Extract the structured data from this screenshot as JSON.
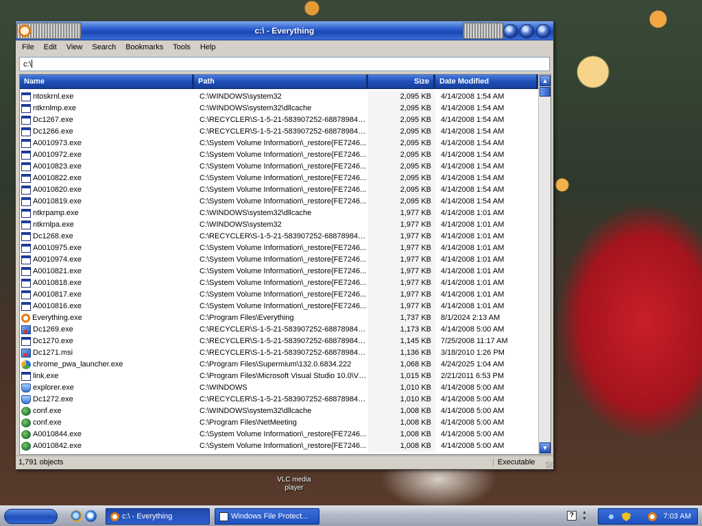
{
  "window": {
    "title": "c:\\ - Everything"
  },
  "menu": [
    "File",
    "Edit",
    "View",
    "Search",
    "Bookmarks",
    "Tools",
    "Help"
  ],
  "search": {
    "value": "c:\\"
  },
  "columns": {
    "name": "Name",
    "path": "Path",
    "size": "Size",
    "date": "Date Modified"
  },
  "rows": [
    {
      "name": "ntoskrnl.exe",
      "path": "C:\\WINDOWS\\system32",
      "size": "2,095 KB",
      "date": "4/14/2008 1:54 AM",
      "icon": "exe"
    },
    {
      "name": "ntkrnlmp.exe",
      "path": "C:\\WINDOWS\\system32\\dllcache",
      "size": "2,095 KB",
      "date": "4/14/2008 1:54 AM",
      "icon": "exe"
    },
    {
      "name": "Dc1267.exe",
      "path": "C:\\RECYCLER\\S-1-5-21-583907252-688789844-...",
      "size": "2,095 KB",
      "date": "4/14/2008 1:54 AM",
      "icon": "exe"
    },
    {
      "name": "Dc1266.exe",
      "path": "C:\\RECYCLER\\S-1-5-21-583907252-688789844-...",
      "size": "2,095 KB",
      "date": "4/14/2008 1:54 AM",
      "icon": "exe"
    },
    {
      "name": "A0010973.exe",
      "path": "C:\\System Volume Information\\_restore{FE7246...",
      "size": "2,095 KB",
      "date": "4/14/2008 1:54 AM",
      "icon": "exe"
    },
    {
      "name": "A0010972.exe",
      "path": "C:\\System Volume Information\\_restore{FE7246...",
      "size": "2,095 KB",
      "date": "4/14/2008 1:54 AM",
      "icon": "exe"
    },
    {
      "name": "A0010823.exe",
      "path": "C:\\System Volume Information\\_restore{FE7246...",
      "size": "2,095 KB",
      "date": "4/14/2008 1:54 AM",
      "icon": "exe"
    },
    {
      "name": "A0010822.exe",
      "path": "C:\\System Volume Information\\_restore{FE7246...",
      "size": "2,095 KB",
      "date": "4/14/2008 1:54 AM",
      "icon": "exe"
    },
    {
      "name": "A0010820.exe",
      "path": "C:\\System Volume Information\\_restore{FE7246...",
      "size": "2,095 KB",
      "date": "4/14/2008 1:54 AM",
      "icon": "exe"
    },
    {
      "name": "A0010819.exe",
      "path": "C:\\System Volume Information\\_restore{FE7246...",
      "size": "2,095 KB",
      "date": "4/14/2008 1:54 AM",
      "icon": "exe"
    },
    {
      "name": "ntkrpamp.exe",
      "path": "C:\\WINDOWS\\system32\\dllcache",
      "size": "1,977 KB",
      "date": "4/14/2008 1:01 AM",
      "icon": "exe"
    },
    {
      "name": "ntkrnlpa.exe",
      "path": "C:\\WINDOWS\\system32",
      "size": "1,977 KB",
      "date": "4/14/2008 1:01 AM",
      "icon": "exe"
    },
    {
      "name": "Dc1268.exe",
      "path": "C:\\RECYCLER\\S-1-5-21-583907252-688789844-...",
      "size": "1,977 KB",
      "date": "4/14/2008 1:01 AM",
      "icon": "exe"
    },
    {
      "name": "A0010975.exe",
      "path": "C:\\System Volume Information\\_restore{FE7246...",
      "size": "1,977 KB",
      "date": "4/14/2008 1:01 AM",
      "icon": "exe"
    },
    {
      "name": "A0010974.exe",
      "path": "C:\\System Volume Information\\_restore{FE7246...",
      "size": "1,977 KB",
      "date": "4/14/2008 1:01 AM",
      "icon": "exe"
    },
    {
      "name": "A0010821.exe",
      "path": "C:\\System Volume Information\\_restore{FE7246...",
      "size": "1,977 KB",
      "date": "4/14/2008 1:01 AM",
      "icon": "exe"
    },
    {
      "name": "A0010818.exe",
      "path": "C:\\System Volume Information\\_restore{FE7246...",
      "size": "1,977 KB",
      "date": "4/14/2008 1:01 AM",
      "icon": "exe"
    },
    {
      "name": "A0010817.exe",
      "path": "C:\\System Volume Information\\_restore{FE7246...",
      "size": "1,977 KB",
      "date": "4/14/2008 1:01 AM",
      "icon": "exe"
    },
    {
      "name": "A0010816.exe",
      "path": "C:\\System Volume Information\\_restore{FE7246...",
      "size": "1,977 KB",
      "date": "4/14/2008 1:01 AM",
      "icon": "exe"
    },
    {
      "name": "Everything.exe",
      "path": "C:\\Program Files\\Everything",
      "size": "1,737 KB",
      "date": "8/1/2024 2:13 AM",
      "icon": "everything"
    },
    {
      "name": "Dc1269.exe",
      "path": "C:\\RECYCLER\\S-1-5-21-583907252-688789844-...",
      "size": "1,173 KB",
      "date": "4/14/2008 5:00 AM",
      "icon": "msi"
    },
    {
      "name": "Dc1270.exe",
      "path": "C:\\RECYCLER\\S-1-5-21-583907252-688789844-...",
      "size": "1,145 KB",
      "date": "7/25/2008 11:17 AM",
      "icon": "exe"
    },
    {
      "name": "Dc1271.msi",
      "path": "C:\\RECYCLER\\S-1-5-21-583907252-688789844-...",
      "size": "1,136 KB",
      "date": "3/18/2010 1:26 PM",
      "icon": "msi"
    },
    {
      "name": "chrome_pwa_launcher.exe",
      "path": "C:\\Program Files\\Supermium\\132.0.6834.222",
      "size": "1,068 KB",
      "date": "4/24/2025 1:04 AM",
      "icon": "chrome"
    },
    {
      "name": "link.exe",
      "path": "C:\\Program Files\\Microsoft Visual Studio 10.0\\VC...",
      "size": "1,015 KB",
      "date": "2/21/2011 6:53 PM",
      "icon": "exe"
    },
    {
      "name": "explorer.exe",
      "path": "C:\\WINDOWS",
      "size": "1,010 KB",
      "date": "4/14/2008 5:00 AM",
      "icon": "explorer"
    },
    {
      "name": "Dc1272.exe",
      "path": "C:\\RECYCLER\\S-1-5-21-583907252-688789844-...",
      "size": "1,010 KB",
      "date": "4/14/2008 5:00 AM",
      "icon": "explorer"
    },
    {
      "name": "conf.exe",
      "path": "C:\\WINDOWS\\system32\\dllcache",
      "size": "1,008 KB",
      "date": "4/14/2008 5:00 AM",
      "icon": "conf"
    },
    {
      "name": "conf.exe",
      "path": "C:\\Program Files\\NetMeeting",
      "size": "1,008 KB",
      "date": "4/14/2008 5:00 AM",
      "icon": "conf"
    },
    {
      "name": "A0010844.exe",
      "path": "C:\\System Volume Information\\_restore{FE7246...",
      "size": "1,008 KB",
      "date": "4/14/2008 5:00 AM",
      "icon": "conf"
    },
    {
      "name": "A0010842.exe",
      "path": "C:\\System Volume Information\\_restore{FE7246...",
      "size": "1,008 KB",
      "date": "4/14/2008 5:00 AM",
      "icon": "conf"
    }
  ],
  "status": {
    "count": "1,791 objects",
    "type": "Executable"
  },
  "desktop": {
    "vlc_label": "VLC media player"
  },
  "taskbar": {
    "tasks": [
      "c:\\ - Everything",
      "Windows File Protect..."
    ],
    "clock": "7:03 AM"
  },
  "colors": {
    "title_bar": "#2b5fd1",
    "header": "#1f4fb8",
    "taskbar": "#b3b9c6"
  }
}
